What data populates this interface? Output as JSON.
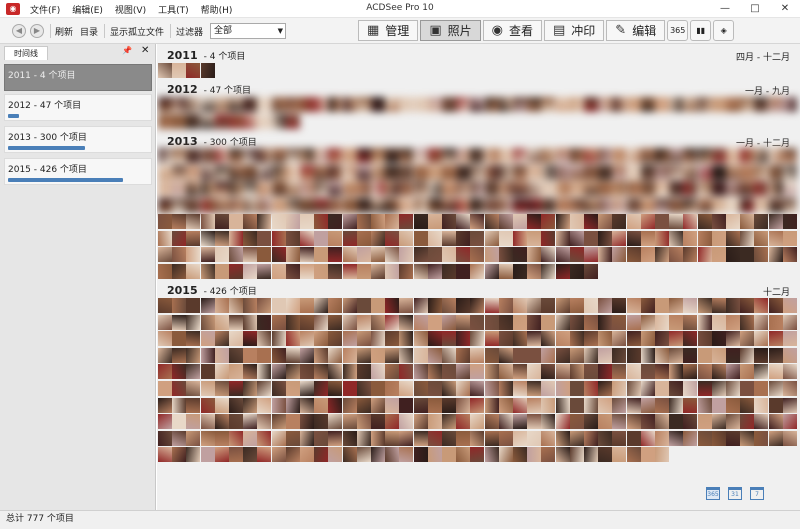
{
  "title": {
    "app_title": "ACDSee Pro 10",
    "minimize": "—",
    "maximize": "□",
    "close": "✕"
  },
  "menu": [
    "文件(F)",
    "编辑(E)",
    "视图(V)",
    "工具(T)",
    "帮助(H)"
  ],
  "toolbar": {
    "back": "◀",
    "forward": "▶",
    "refresh": "刷新",
    "catalog": "目录",
    "show_isolated": "显示孤立文件",
    "filter_label": "过滤器",
    "filter_value": "全部"
  },
  "modes": [
    {
      "label": "管理",
      "icon": "grid-icon",
      "active": false
    },
    {
      "label": "照片",
      "icon": "photos-icon",
      "active": true
    },
    {
      "label": "查看",
      "icon": "eye-icon",
      "active": false
    },
    {
      "label": "冲印",
      "icon": "develop-icon",
      "active": false
    },
    {
      "label": "编辑",
      "icon": "edit-icon",
      "active": false
    }
  ],
  "extra_buttons": [
    "365",
    "dashboard-icon",
    "online-icon"
  ],
  "timeline_pane": {
    "tab_label": "时间线",
    "items": [
      {
        "label": "2011 - 4 个项目",
        "fraction": 0.01
      },
      {
        "label": "2012 - 47 个项目",
        "fraction": 0.08
      },
      {
        "label": "2013 - 300 个项目",
        "fraction": 0.55
      },
      {
        "label": "2015 - 426 个项目",
        "fraction": 0.82
      }
    ]
  },
  "years": [
    {
      "year": "2011",
      "count": "- 4 个项目",
      "months": "四月 - 十二月"
    },
    {
      "year": "2012",
      "count": "- 47 个项目",
      "months": "一月 - 九月"
    },
    {
      "year": "2013",
      "count": "- 300 个项目",
      "months": "一月 - 十二月"
    },
    {
      "year": "2015",
      "count": "- 426 个项目",
      "months": "十二月"
    }
  ],
  "view_icons": [
    "year-view-icon",
    "month-view-icon",
    "day-view-icon"
  ],
  "view_icon_labels": [
    "365",
    "31",
    "7"
  ],
  "status": {
    "text": "总计 777 个项目"
  },
  "colors": {
    "accent": "#4a7fb8",
    "close_red": "#c82828"
  }
}
